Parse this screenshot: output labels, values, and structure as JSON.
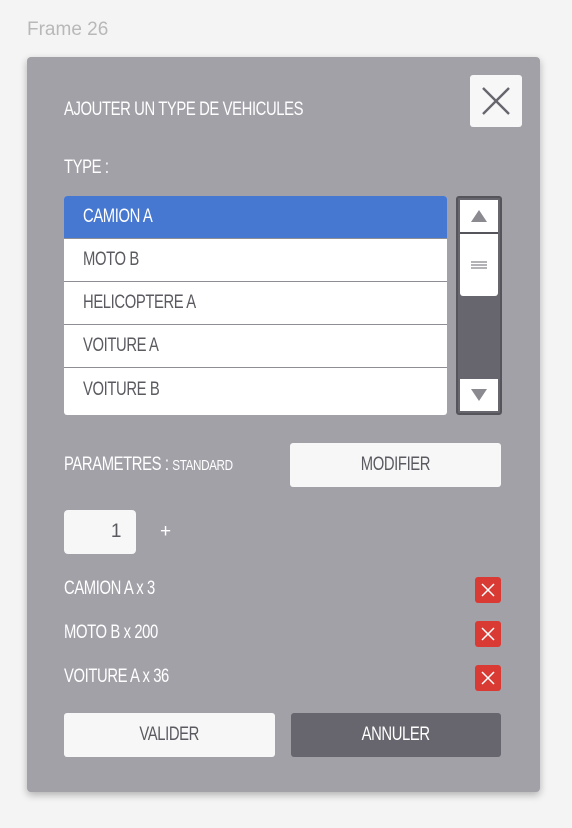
{
  "frame_label": "Frame 26",
  "dialog": {
    "title": "AJOUTER UN TYPE DE VEHICULES",
    "type_label": "TYPE :",
    "types": [
      {
        "label": "CAMION A",
        "selected": true
      },
      {
        "label": "MOTO B",
        "selected": false
      },
      {
        "label": "HELICOPTERE A",
        "selected": false
      },
      {
        "label": "VOITURE A",
        "selected": false
      },
      {
        "label": "VOITURE B",
        "selected": false
      }
    ],
    "parameters_label": "PARAMETRES :",
    "parameters_value": "STANDARD",
    "modify_button": "MODIFIER",
    "quantity": "1",
    "add_label": "+",
    "selected_items": [
      {
        "label": "CAMION A x 3"
      },
      {
        "label": "MOTO B x 200"
      },
      {
        "label": "VOITURE A x  36"
      }
    ],
    "validate_button": "VALIDER",
    "cancel_button": "ANNULER"
  },
  "icons": {
    "close": "close-icon",
    "scroll_up": "triangle-up-icon",
    "scroll_down": "triangle-down-icon",
    "scroll_grip": "grip-lines-icon",
    "delete": "close-icon"
  },
  "colors": {
    "dialog_bg": "#a2a1a8",
    "selected_row": "#4678d2",
    "delete_red": "#d93b34",
    "dark_button": "#67666e"
  }
}
